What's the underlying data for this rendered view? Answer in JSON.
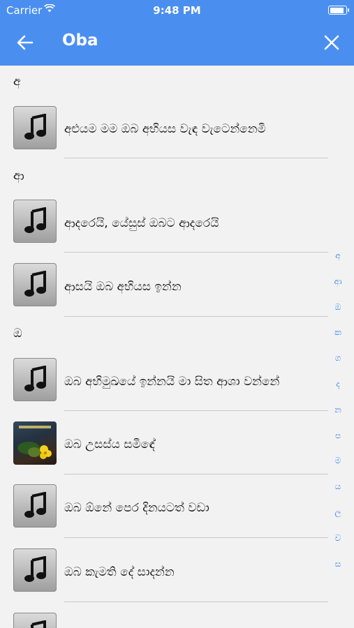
{
  "status_bar": {
    "carrier": "Carrier",
    "time": "9:48 PM"
  },
  "header": {
    "title": "Oba",
    "back_icon": "arrow-left-icon",
    "close_icon": "close-icon",
    "color": "#4a8ff0"
  },
  "sections": [
    {
      "letter": "අ",
      "items": [
        "අළුයම මම ඔබ අභියස වැඳ වැටෙන්නෙමි"
      ]
    },
    {
      "letter": "ආ",
      "items": [
        "ආදරෙයි, යේසුස් ඔබට ආදරෙයි",
        "ආසයි ඔබ අභියස ඉන්න"
      ]
    },
    {
      "letter": "ඔ",
      "items": [
        "ඔබ අභිමුඛයේ ඉන්නයි මා සිත ආශා වන්නේ",
        "ඔබ උසස්ය සමිඳේ",
        "ඔබ ඕනේ පෙර දිනයටත් වඩා",
        "ඔබ කැමති දේ සාදන්න"
      ]
    }
  ],
  "thumbnail_icons": [
    "music-note-icon",
    "music-note-icon",
    "music-note-icon",
    "music-note-icon",
    "album-art-image",
    "music-note-icon",
    "music-note-icon",
    "music-note-icon"
  ],
  "index_letters": [
    "අ",
    "ආ",
    "ඔ",
    "ක",
    "ග",
    "ද",
    "න",
    "ප",
    "ම",
    "ය",
    "ල",
    "ව",
    "ස"
  ],
  "accent_color": "#3a86e8"
}
